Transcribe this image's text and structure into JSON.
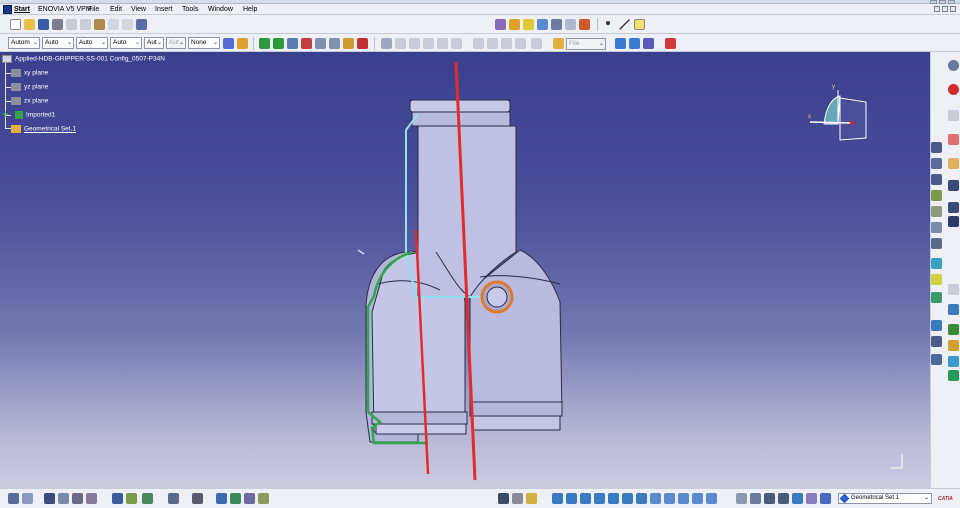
{
  "menubar": {
    "items": [
      "Start",
      "ENOVIA V5 VPM",
      "File",
      "Edit",
      "View",
      "Insert",
      "Tools",
      "Window",
      "Help"
    ]
  },
  "toolbar2": {
    "combos": [
      "Autom",
      "Auto",
      "Auto",
      "Auto",
      "Aut",
      "Aut",
      "None",
      "File"
    ]
  },
  "tree": {
    "root": "Applied-HDB-GRIPPER-SS-001 Config_0507-P34N",
    "nodes": [
      "xy plane",
      "yz plane",
      "zx plane",
      "Imported1",
      "Geometrical Set.1"
    ]
  },
  "compass": {
    "x_label": "x",
    "y_label": "y"
  },
  "status": {
    "set_select": "Geometrical Set.1",
    "logo": "CATIA"
  },
  "colors": {
    "viewport_top": "#3a3f8e",
    "viewport_bottom": "#cbcbe0",
    "part_fill": "#b9bbde",
    "edge_red": "#e22b2b",
    "edge_cyan": "#8fe3f0",
    "edge_green": "#2fa84a",
    "edge_orange": "#e07a2a"
  }
}
